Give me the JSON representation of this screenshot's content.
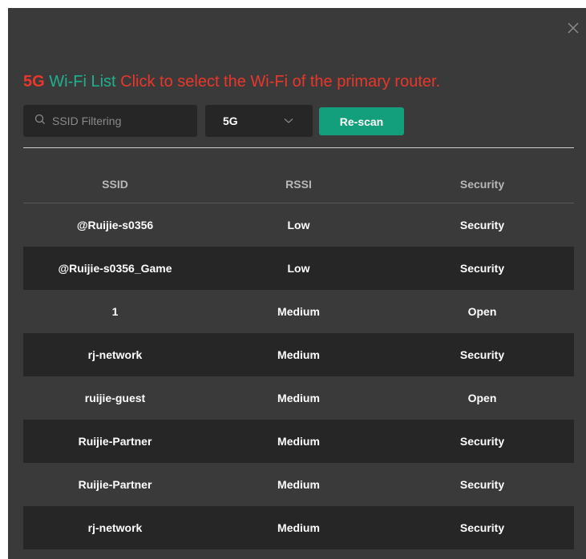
{
  "dialog": {
    "close_icon": "close-icon",
    "title_band": "5G",
    "title_list": " Wi-Fi List ",
    "title_hint": "Click to select the Wi-Fi of the primary router."
  },
  "filter": {
    "search_placeholder": "SSID Filtering",
    "search_value": "",
    "search_icon": "search-icon",
    "band_selected": "5G",
    "band_icon": "chevron-down-icon",
    "rescan_label": "Re-scan"
  },
  "colors": {
    "accent_green": "#139e7c",
    "title_red": "#e8372b",
    "title_green": "#1fb18f"
  },
  "table": {
    "columns": [
      "SSID",
      "RSSI",
      "Security"
    ],
    "rows": [
      {
        "ssid": "@Ruijie-s0356",
        "rssi": "Low",
        "security": "Security"
      },
      {
        "ssid": "@Ruijie-s0356_Game",
        "rssi": "Low",
        "security": "Security"
      },
      {
        "ssid": "1",
        "rssi": "Medium",
        "security": "Open"
      },
      {
        "ssid": "rj-network",
        "rssi": "Medium",
        "security": "Security"
      },
      {
        "ssid": "ruijie-guest",
        "rssi": "Medium",
        "security": "Open"
      },
      {
        "ssid": "Ruijie-Partner",
        "rssi": "Medium",
        "security": "Security"
      },
      {
        "ssid": "Ruijie-Partner",
        "rssi": "Medium",
        "security": "Security"
      },
      {
        "ssid": "rj-network",
        "rssi": "Medium",
        "security": "Security"
      }
    ]
  }
}
